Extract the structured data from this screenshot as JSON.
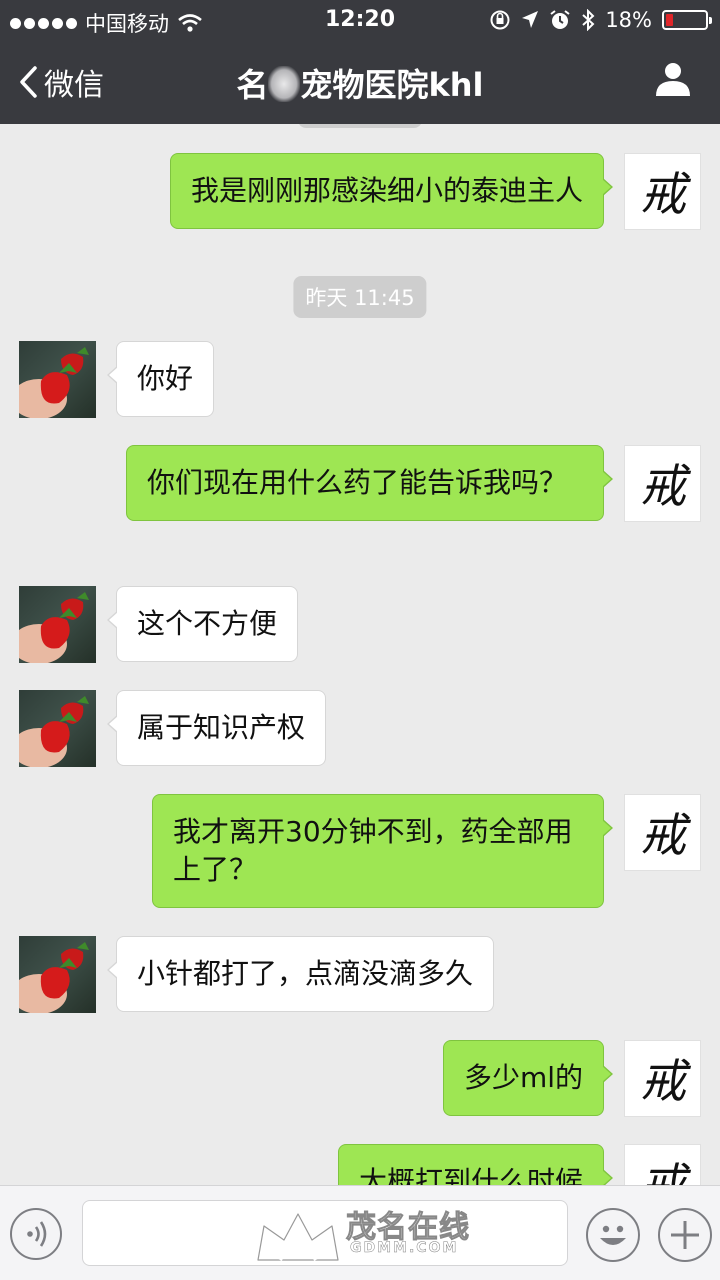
{
  "status_bar": {
    "carrier": "中国移动",
    "time": "12:20",
    "battery_percent": "18%",
    "battery_level": 0.18
  },
  "nav": {
    "back_label": "微信",
    "title_prefix": "名",
    "title_suffix": "宠物医院khl"
  },
  "messages": [
    {
      "sender": "self",
      "text": "我是刚刚那感染细小的泰迪主人"
    },
    {
      "type": "time",
      "text": "昨天 11:45"
    },
    {
      "sender": "other",
      "text": "你好"
    },
    {
      "sender": "self",
      "text": "你们现在用什么药了能告诉我吗？"
    },
    {
      "sender": "other",
      "text": "这个不方便"
    },
    {
      "sender": "other",
      "text": "属于知识产权"
    },
    {
      "sender": "self",
      "text": "我才离开30分钟不到，药全部用上了？"
    },
    {
      "sender": "other",
      "text": "小针都打了，点滴没滴多久"
    },
    {
      "sender": "self",
      "text": "多少ml的"
    },
    {
      "sender": "self",
      "text": "大概打到什么时候"
    }
  ],
  "self_avatar_glyph": "戒",
  "watermark": {
    "text": "茂名在线",
    "sub": "GDMM.COM"
  },
  "colors": {
    "header_bg": "#393a3f",
    "self_bubble": "#9ee653",
    "other_bubble": "#ffffff",
    "background": "#ebebeb",
    "battery_low": "#e0262a"
  }
}
